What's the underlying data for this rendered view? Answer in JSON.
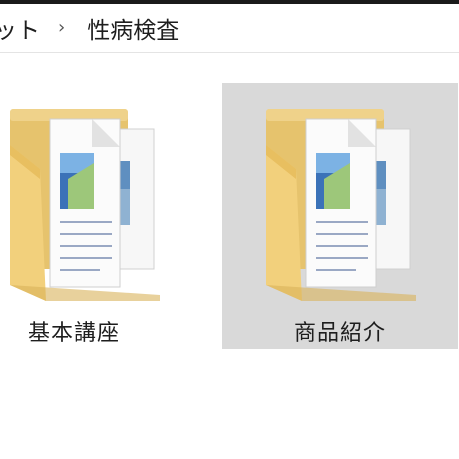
{
  "breadcrumb": {
    "parent_partial": "ット",
    "separator": "›",
    "current": "性病検査"
  },
  "folders": [
    {
      "label": "基本講座",
      "selected": false
    },
    {
      "label": "商品紹介",
      "selected": true
    }
  ],
  "colors": {
    "selection": "#d9d9d9",
    "folder_back": "#e8c572",
    "folder_front": "#f3d27f"
  }
}
